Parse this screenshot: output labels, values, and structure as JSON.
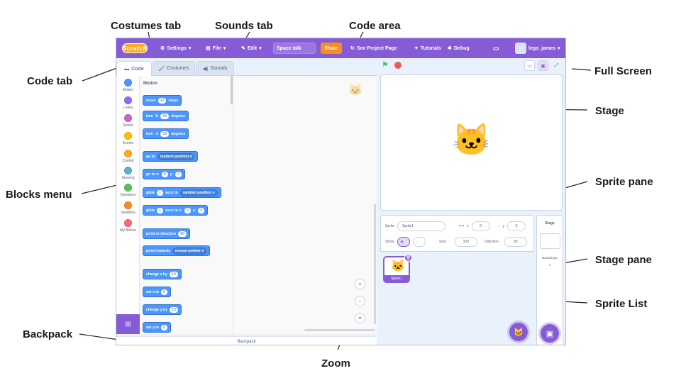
{
  "annotations": {
    "costumes_tab": "Costumes tab",
    "sounds_tab": "Sounds tab",
    "code_area": "Code area",
    "code_tab": "Code tab",
    "full_screen": "Full Screen",
    "stage": "Stage",
    "sprite_pane": "Sprite pane",
    "blocks_menu": "Blocks menu",
    "stage_pane": "Stage pane",
    "sprite_list": "Sprite List",
    "backpack": "Backpack",
    "zoom": "Zoom"
  },
  "menubar": {
    "logo": "Scratch",
    "settings": "Settings",
    "file": "File",
    "edit": "Edit",
    "project_title": "Space talk",
    "share": "Share",
    "see_project_page": "See Project Page",
    "tutorials": "Tutorials",
    "debug": "Debug",
    "username": "lego_james"
  },
  "tabs": {
    "code": "Code",
    "costumes": "Costumes",
    "sounds": "Sounds"
  },
  "categories": [
    {
      "label": "Motion",
      "color": "#4c97ff"
    },
    {
      "label": "Looks",
      "color": "#9966ff"
    },
    {
      "label": "Sound",
      "color": "#cf63cf"
    },
    {
      "label": "Events",
      "color": "#ffbf00"
    },
    {
      "label": "Control",
      "color": "#ffab19"
    },
    {
      "label": "Sensing",
      "color": "#5cb1d6"
    },
    {
      "label": "Operators",
      "color": "#59c059"
    },
    {
      "label": "Variables",
      "color": "#ff8c1a"
    },
    {
      "label": "My Blocks",
      "color": "#ff6680"
    }
  ],
  "flyout": {
    "title": "Motion",
    "move": {
      "a": "move",
      "v": "10",
      "b": "steps"
    },
    "turn_right": {
      "a": "turn",
      "v": "15",
      "b": "degrees"
    },
    "turn_left": {
      "a": "turn",
      "v": "15",
      "b": "degrees"
    },
    "go_to": {
      "a": "go to",
      "d": "random position"
    },
    "go_to_xy": {
      "a": "go to x:",
      "x": "0",
      "b": "y:",
      "y": "0"
    },
    "glide_to": {
      "a": "glide",
      "v": "1",
      "b": "secs to",
      "d": "random position"
    },
    "glide_xy": {
      "a": "glide",
      "v": "1",
      "b": "secs to x:",
      "x": "0",
      "c": "y:",
      "y": "0"
    },
    "point_dir": {
      "a": "point in direction",
      "v": "90"
    },
    "point_towards": {
      "a": "point towards",
      "d": "mouse-pointer"
    },
    "change_x": {
      "a": "change x by",
      "v": "10"
    },
    "set_x": {
      "a": "set x to",
      "v": "0"
    },
    "change_y": {
      "a": "change y by",
      "v": "10"
    },
    "set_y": {
      "a": "set y to",
      "v": "0"
    }
  },
  "zoom": {
    "in": "+",
    "out": "−",
    "reset": "="
  },
  "backpack_label": "Backpack",
  "sprite_info": {
    "sprite_label": "Sprite",
    "sprite_name": "Sprite1",
    "x_label": "x",
    "x_value": "0",
    "y_label": "y",
    "y_value": "0",
    "show_label": "Show",
    "size_label": "Size",
    "size_value": "100",
    "direction_label": "Direction",
    "direction_value": "90"
  },
  "sprite_list": [
    {
      "name": "Sprite1"
    }
  ],
  "stage_pane": {
    "title": "Stage",
    "backdrops_label": "Backdrops",
    "backdrops_count": "1"
  },
  "colors": {
    "accent": "#855cd6",
    "share": "#ff8c1a",
    "motion": "#4c97ff"
  }
}
